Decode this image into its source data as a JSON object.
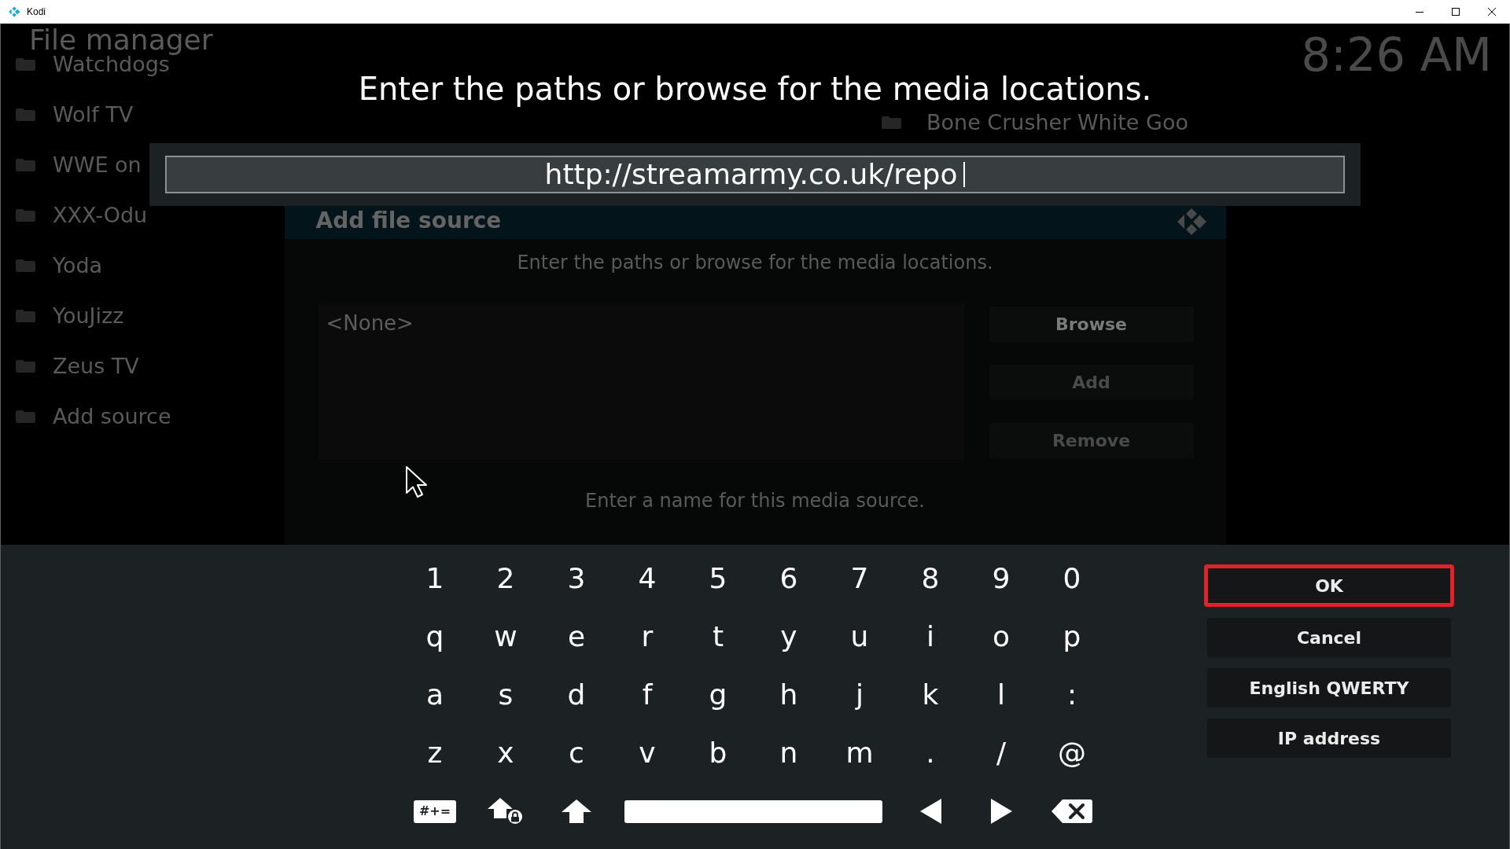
{
  "window": {
    "title": "Kodi"
  },
  "file_manager": {
    "title": "File manager",
    "clock": "8:26 AM",
    "left_list": [
      "Watchdogs",
      "Wolf TV",
      "WWE on",
      "XXX-Odu",
      "Yoda",
      "YouJizz",
      "Zeus TV",
      "Add source"
    ],
    "right_list": [
      "Bone Crusher White Goo"
    ]
  },
  "add_source_dialog": {
    "title": "Add file source",
    "path_prompt": "Enter the paths or browse for the media locations.",
    "paths": [
      "<None>"
    ],
    "buttons": [
      {
        "label": "Browse",
        "disabled": false
      },
      {
        "label": "Add",
        "disabled": true
      },
      {
        "label": "Remove",
        "disabled": true
      }
    ],
    "name_prompt": "Enter a name for this media source."
  },
  "keyboard": {
    "heading": "Enter the paths or browse for the media locations.",
    "input": {
      "value": "http://streamarmy.co.uk/repo"
    },
    "key_rows": [
      [
        "1",
        "2",
        "3",
        "4",
        "5",
        "6",
        "7",
        "8",
        "9",
        "0"
      ],
      [
        "q",
        "w",
        "e",
        "r",
        "t",
        "y",
        "u",
        "i",
        "o",
        "p"
      ],
      [
        "a",
        "s",
        "d",
        "f",
        "g",
        "h",
        "j",
        "k",
        "l",
        ":"
      ],
      [
        "z",
        "x",
        "c",
        "v",
        "b",
        "n",
        "m",
        ".",
        "/",
        "@"
      ]
    ],
    "function_keys": [
      {
        "kind": "symbols",
        "label": "#+="
      },
      {
        "kind": "caps_lock"
      },
      {
        "kind": "shift"
      },
      {
        "kind": "space"
      },
      {
        "kind": "left"
      },
      {
        "kind": "right"
      },
      {
        "kind": "backspace"
      }
    ],
    "buttons": [
      {
        "label": "OK",
        "selected": true
      },
      {
        "label": "Cancel",
        "selected": false
      },
      {
        "label": "English QWERTY",
        "selected": false
      },
      {
        "label": "IP address",
        "selected": false
      }
    ]
  }
}
